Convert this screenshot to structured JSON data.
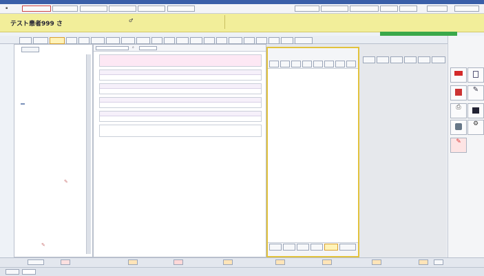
{
  "window": {
    "title": ""
  },
  "menubar": {
    "items": [
      "",
      "",
      "",
      "",
      "",
      "",
      "",
      "",
      "",
      "",
      "",
      "",
      "",
      "",
      ""
    ]
  },
  "header": {
    "patient_name": "テスト患者999 さ",
    "left_lines": [
      "",
      ""
    ],
    "mid_lines": [
      "",
      "",
      ""
    ],
    "right_lines": [
      "",
      ""
    ]
  },
  "tabs": [
    "",
    "",
    "",
    "",
    "",
    "",
    "",
    "",
    "",
    "",
    "",
    "",
    "",
    "",
    "",
    "",
    "",
    "",
    "",
    "",
    ""
  ],
  "tree": {
    "items": [
      "",
      "",
      "",
      "",
      "",
      "",
      "",
      "",
      "",
      "",
      "",
      "",
      "",
      "",
      "",
      "",
      "",
      "",
      "",
      "",
      "",
      "",
      "",
      "",
      "",
      "",
      "",
      "",
      "",
      "",
      "",
      "",
      "",
      "",
      ""
    ]
  },
  "center": {
    "notes": [
      "",
      "",
      "",
      "",
      ""
    ],
    "footer_text": ""
  },
  "editor": {
    "toolbar": [
      "",
      "",
      "",
      "",
      "",
      "",
      "",
      ""
    ],
    "tabs": [
      "",
      "",
      "",
      "",
      "",
      ""
    ]
  },
  "right_toolbar": [
    "",
    "",
    "",
    "",
    "",
    ""
  ],
  "icons": {
    "red_mark": "red-square-icon",
    "pen": "pen-icon",
    "calendar": "calendar-icon",
    "print": "printer-icon",
    "disk": "disk-icon",
    "red_bottom": "red-mark-icon"
  },
  "bottom_tabs": [
    "",
    "",
    "",
    "",
    "",
    "",
    "",
    "",
    "",
    ""
  ],
  "statusbar": {
    "left": "",
    "right": ""
  },
  "colors": {
    "title_bar": "#3a5fa8",
    "header_bg": "#f2ee9a",
    "editor_border": "#e2c23c",
    "green_bar": "#3aa84a",
    "active_tab": "#fff3b8"
  }
}
